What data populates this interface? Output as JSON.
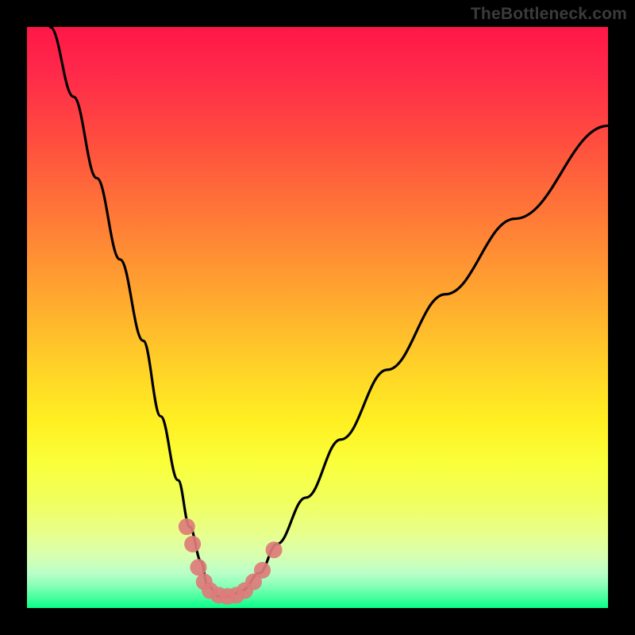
{
  "watermark": "TheBottleneck.com",
  "chart_data": {
    "type": "line",
    "title": "",
    "xlabel": "",
    "ylabel": "",
    "xlim": [
      0,
      100
    ],
    "ylim": [
      0,
      100
    ],
    "grid": false,
    "legend": false,
    "annotations": [],
    "series": [
      {
        "name": "bottleneck-curve",
        "color": "#000000",
        "x": [
          4,
          8,
          12,
          16,
          20,
          23,
          26,
          28,
          30,
          31,
          33,
          35,
          37,
          40,
          43,
          48,
          54,
          62,
          72,
          84,
          100
        ],
        "values": [
          100,
          88,
          74,
          60,
          46,
          33,
          22,
          14,
          8,
          4,
          2,
          2,
          3,
          6,
          11,
          19,
          29,
          41,
          54,
          67,
          83
        ]
      }
    ],
    "markers": {
      "name": "highlight-points",
      "color": "#dd7c79",
      "points": [
        {
          "x": 27.5,
          "y": 14
        },
        {
          "x": 28.5,
          "y": 11
        },
        {
          "x": 29.5,
          "y": 7
        },
        {
          "x": 30.5,
          "y": 4.5
        },
        {
          "x": 31.5,
          "y": 3
        },
        {
          "x": 33.0,
          "y": 2.2
        },
        {
          "x": 34.5,
          "y": 2
        },
        {
          "x": 36.0,
          "y": 2.2
        },
        {
          "x": 37.5,
          "y": 3
        },
        {
          "x": 39.0,
          "y": 4.5
        },
        {
          "x": 40.5,
          "y": 6.5
        },
        {
          "x": 42.5,
          "y": 10
        }
      ]
    },
    "background_gradient": {
      "top": "#ff1747",
      "middle": "#ffe030",
      "bottom": "#08ff88"
    }
  }
}
